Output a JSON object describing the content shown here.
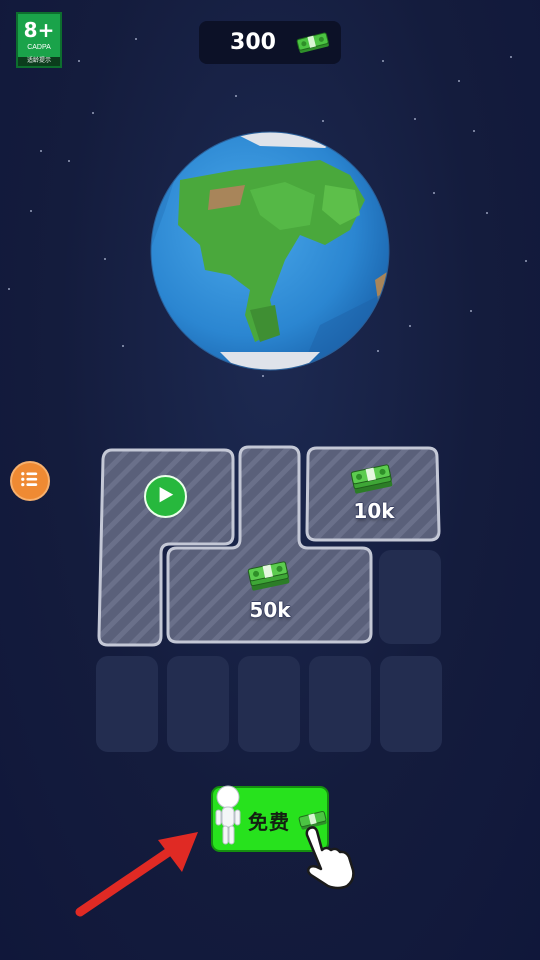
{
  "age_rating": {
    "label": "8+",
    "sublabel": "CADPA",
    "footer": "适龄提示"
  },
  "currency": {
    "value": "300",
    "icon": "cash-icon"
  },
  "menu": {
    "icon": "list-icon",
    "color": "#ef8a33"
  },
  "tiles": [
    {
      "kind": "video",
      "icon": "play-icon"
    },
    {
      "kind": "reward",
      "label": "10k",
      "icon": "cash-stack-icon"
    },
    {
      "kind": "reward",
      "label": "50k",
      "icon": "cash-stack-icon"
    }
  ],
  "free_button": {
    "label": "免费",
    "color": "#27e21d"
  },
  "tutorial": {
    "arrow_icon": "red-arrow-icon",
    "hand_icon": "pointing-hand-icon"
  }
}
